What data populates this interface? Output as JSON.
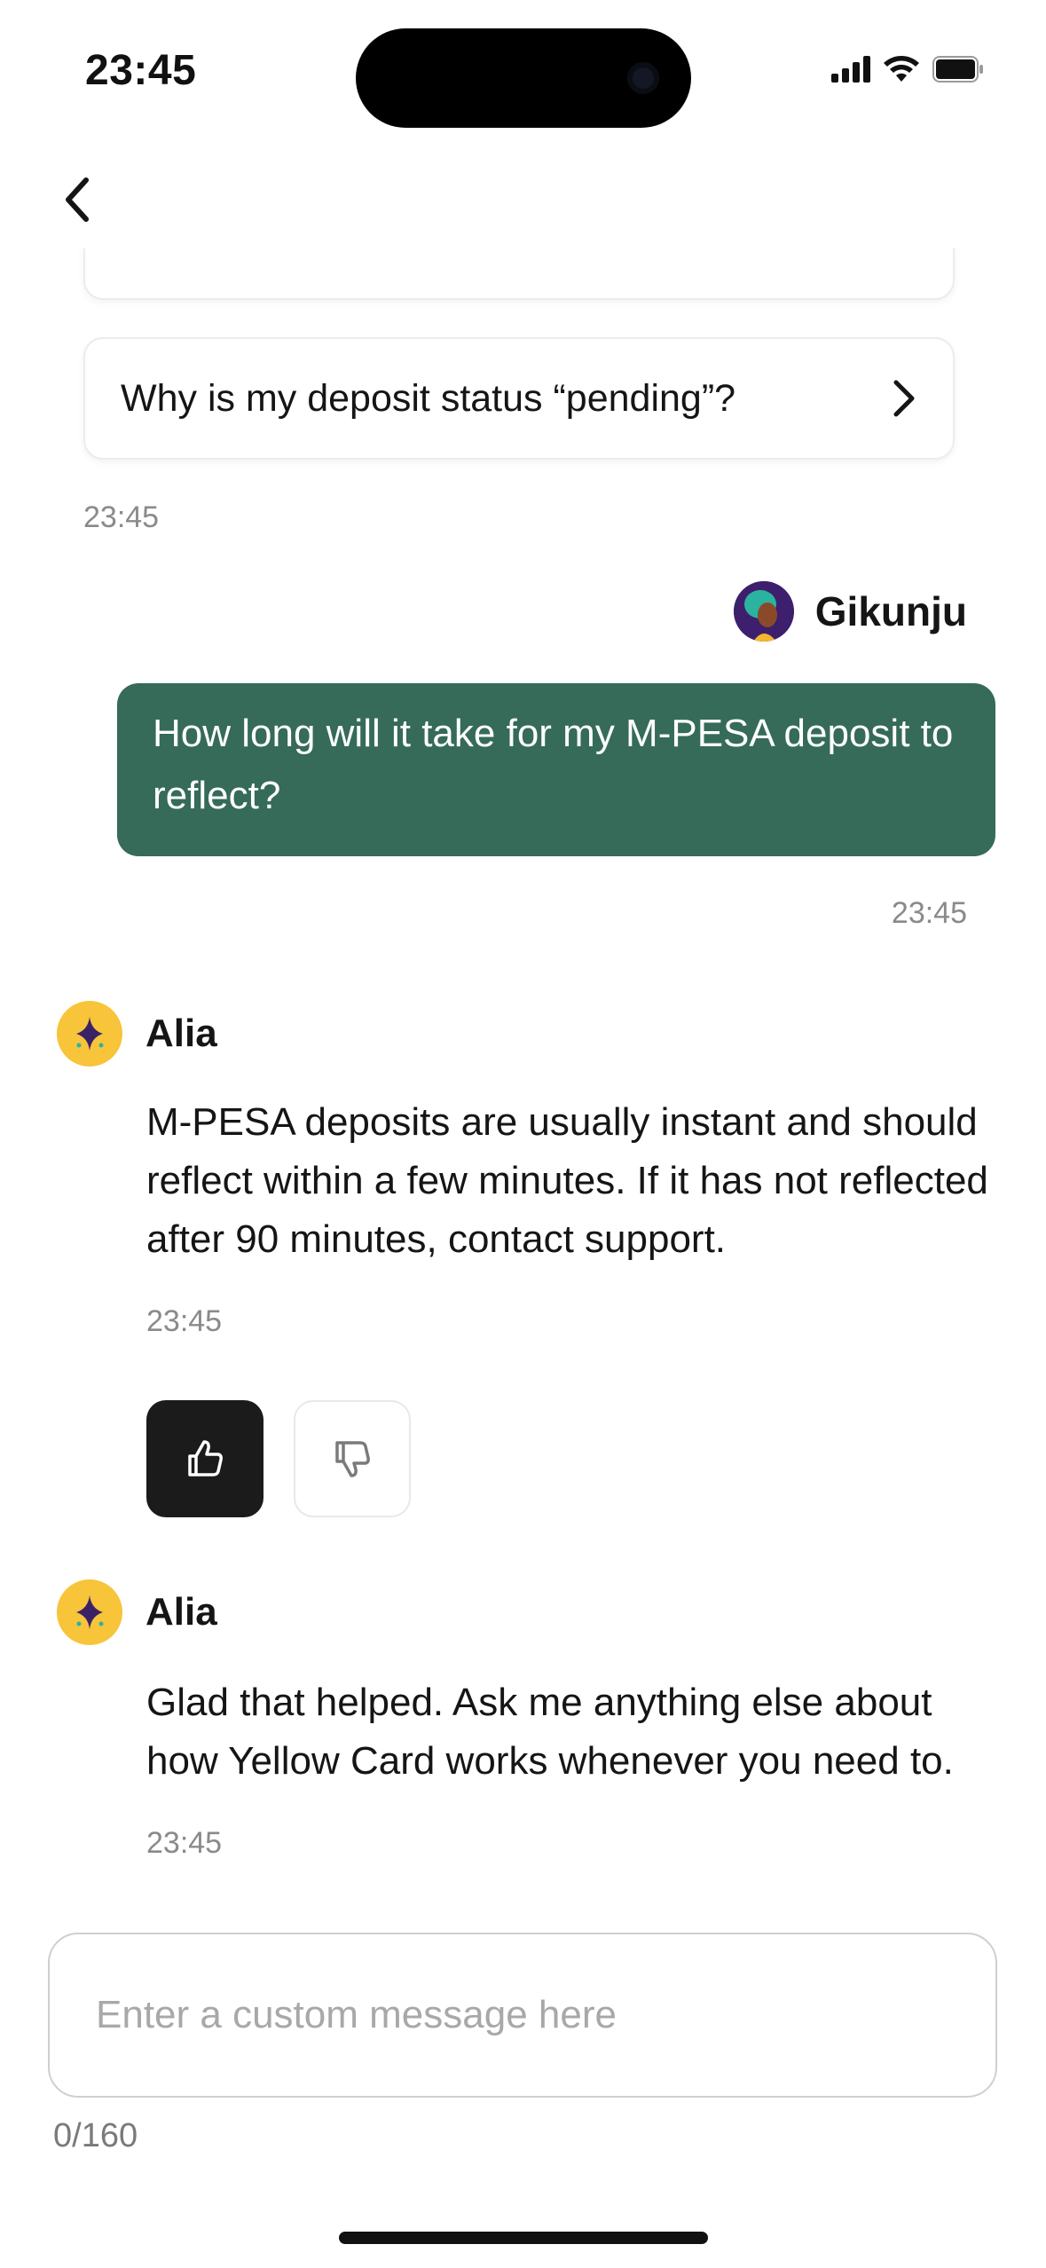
{
  "status_bar": {
    "time": "23:45"
  },
  "nav": {
    "back_icon": "chevron-left-icon"
  },
  "suggestions": [
    {
      "label": ""
    },
    {
      "label": "Why is my deposit status “pending”?"
    }
  ],
  "messages": {
    "suggestions_time": "23:45",
    "user": {
      "name": "Gikunju",
      "text": "How long will it take for my M-PESA deposit to reflect?",
      "time": "23:45"
    },
    "bot_1": {
      "name": "Alia",
      "text": "M-PESA deposits are usually instant and should reflect within a few minutes. If it has not reflected after 90 minutes, contact support.",
      "time": "23:45"
    },
    "bot_2": {
      "name": "Alia",
      "text": "Glad that helped. Ask me anything else about how Yellow Card works whenever you need to.",
      "time": "23:45"
    }
  },
  "feedback": {
    "thumbs_up_icon": "thumbs-up-icon",
    "thumbs_down_icon": "thumbs-down-icon",
    "selected": "up"
  },
  "composer": {
    "placeholder": "Enter a custom message here",
    "value": "",
    "counter": "0/160"
  },
  "colors": {
    "user_bubble": "#356b58",
    "bot_avatar": "#f7c43a",
    "thumbs_up_selected": "#1b1b1b"
  }
}
